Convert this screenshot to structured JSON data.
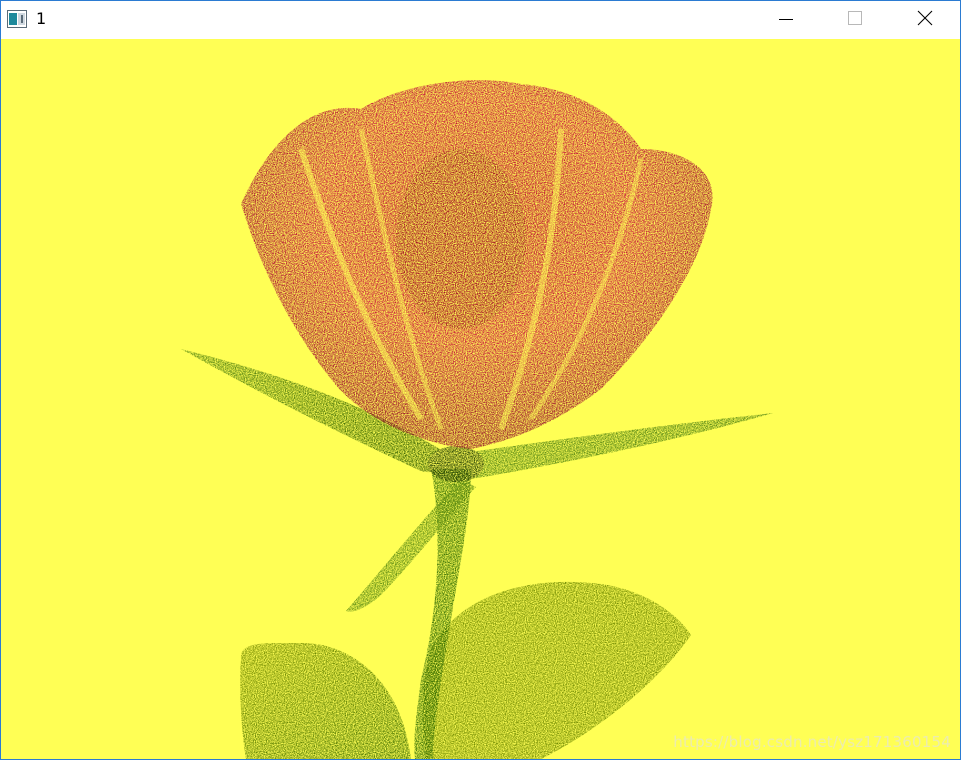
{
  "window": {
    "title": "1",
    "app_icon": "window-app-icon",
    "controls": {
      "minimize_icon": "minimize-icon",
      "maximize_icon": "maximize-icon",
      "close_icon": "close-icon"
    }
  },
  "canvas": {
    "background_color": "#ffff55",
    "subject": "rose",
    "petal_color": "#c0103a",
    "petal_dark_color": "#7a0020",
    "leaf_color": "#6b8a00",
    "stem_color": "#2f6b00"
  },
  "watermark": {
    "text": "https://blog.csdn.net/ysz171360154"
  }
}
